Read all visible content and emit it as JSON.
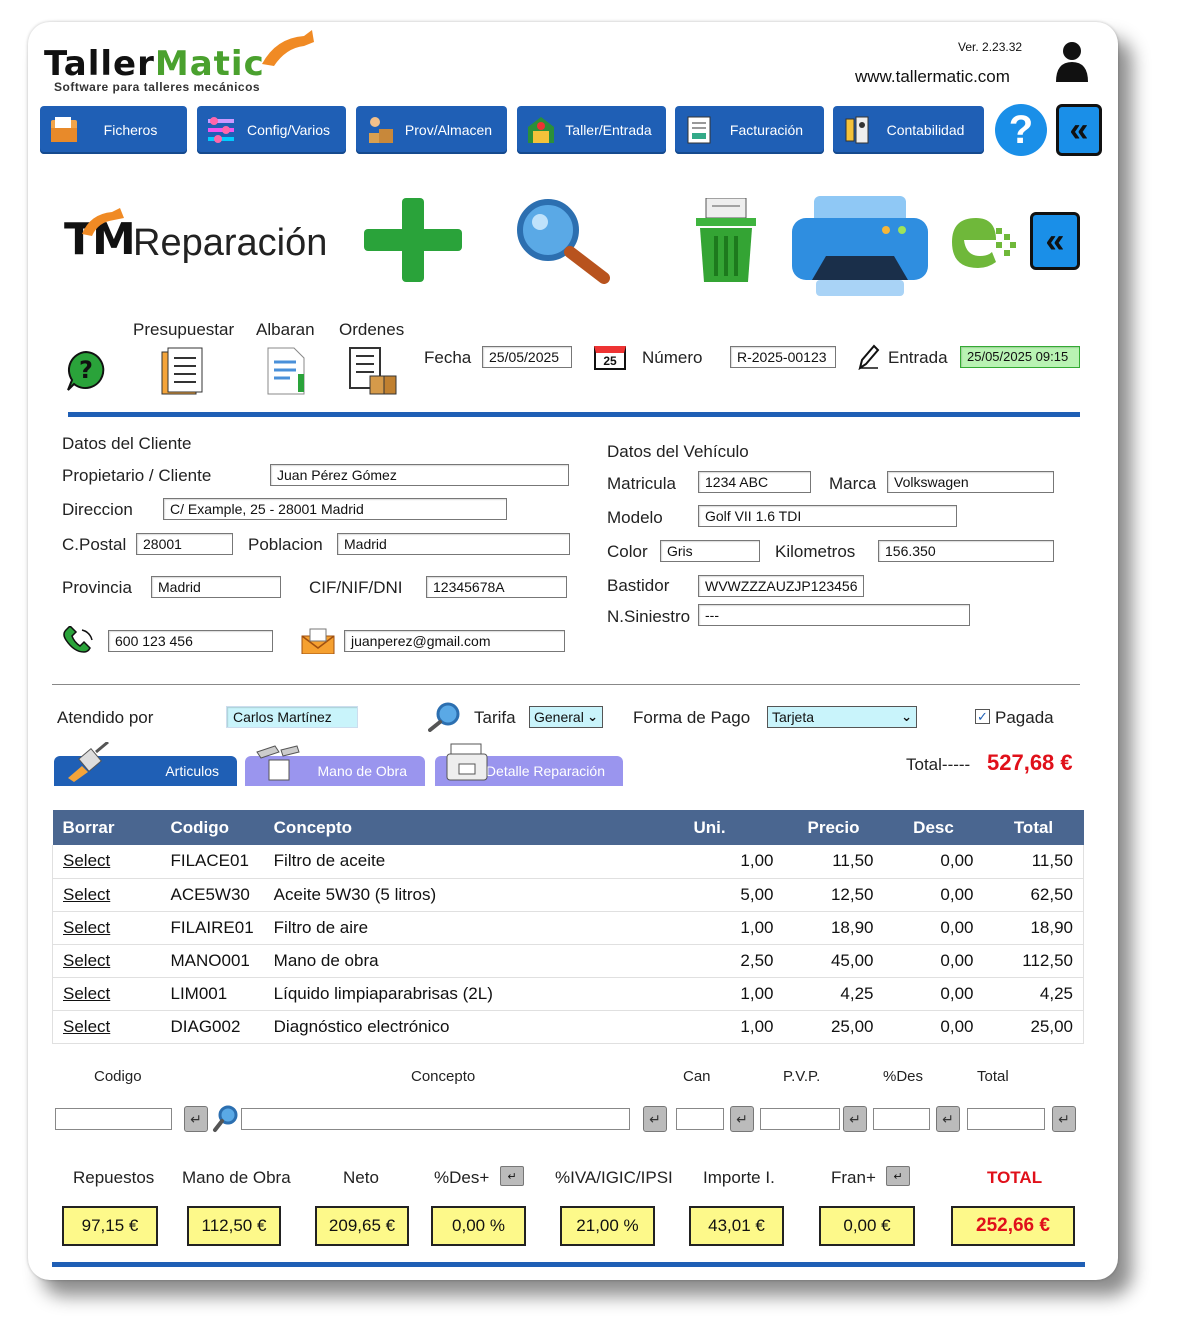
{
  "app": {
    "logo_first": "Taller",
    "logo_second": "Matic",
    "tagline": "Software para talleres mecánicos",
    "version": "Ver. 2.23.32",
    "website": "www.tallermatic.com"
  },
  "nav": {
    "items": [
      {
        "label": "Ficheros"
      },
      {
        "label": "Config/Varios"
      },
      {
        "label": "Prov/Almacen"
      },
      {
        "label": "Taller/Entrada"
      },
      {
        "label": "Facturación"
      },
      {
        "label": "Contabilidad"
      }
    ],
    "help": "?",
    "back": "«"
  },
  "page": {
    "logo": "TM",
    "title": "Reparación"
  },
  "docs": {
    "presupuestar": "Presupuestar",
    "albaran": "Albaran",
    "ordenes": "Ordenes"
  },
  "header_fields": {
    "fecha_label": "Fecha",
    "fecha": "25/05/2025",
    "calendar_day": "25",
    "numero_label": "Número",
    "numero": "R-2025-00123",
    "entrada_label": "Entrada",
    "entrada": "25/05/2025 09:15"
  },
  "cliente": {
    "section": "Datos del Cliente",
    "propietario_label": "Propietario / Cliente",
    "propietario": "Juan Pérez Gómez",
    "direccion_label": "Direccion",
    "direccion": "C/ Example, 25 - 28001 Madrid",
    "cpostal_label": "C.Postal",
    "cpostal": "28001",
    "poblacion_label": "Poblacion",
    "poblacion": "Madrid",
    "provincia_label": "Provincia",
    "provincia": "Madrid",
    "cif_label": "CIF/NIF/DNI",
    "cif": "12345678A",
    "telefono": "600 123 456",
    "email": "juanperez@gmail.com"
  },
  "vehiculo": {
    "section": "Datos del Vehículo",
    "matricula_label": "Matricula",
    "matricula": "1234 ABC",
    "marca_label": "Marca",
    "marca": "Volkswagen",
    "modelo_label": "Modelo",
    "modelo": "Golf VII 1.6 TDI",
    "color_label": "Color",
    "color": "Gris",
    "km_label": "Kilometros",
    "km": "156.350",
    "bastidor_label": "Bastidor",
    "bastidor": "WVWZZZAUZJP123456",
    "siniestro_label": "N.Siniestro",
    "siniestro": "---"
  },
  "atencion": {
    "atendido_label": "Atendido por",
    "atendido": "Carlos Martínez",
    "tarifa_label": "Tarifa",
    "tarifa": "General",
    "pago_label": "Forma de Pago",
    "pago": "Tarjeta",
    "pagada_label": "Pagada",
    "pagada_checked": true,
    "total_label": "Total-----",
    "total": "527,68 €"
  },
  "tabs": [
    {
      "label": "Articulos"
    },
    {
      "label": "Mano de Obra"
    },
    {
      "label": "Detalle Reparación"
    }
  ],
  "table": {
    "headers": [
      "Borrar",
      "Codigo",
      "Concepto",
      "Uni.",
      "Precio",
      "Desc",
      "Total"
    ],
    "rows": [
      {
        "action": "Select",
        "codigo": "FILACE01",
        "concepto": "Filtro de aceite",
        "uni": "1,00",
        "precio": "11,50",
        "desc": "0,00",
        "total": "11,50"
      },
      {
        "action": "Select",
        "codigo": "ACE5W30",
        "concepto": "Aceite 5W30 (5 litros)",
        "uni": "5,00",
        "precio": "12,50",
        "desc": "0,00",
        "total": "62,50"
      },
      {
        "action": "Select",
        "codigo": "FILAIRE01",
        "concepto": "Filtro de aire",
        "uni": "1,00",
        "precio": "18,90",
        "desc": "0,00",
        "total": "18,90"
      },
      {
        "action": "Select",
        "codigo": "MANO001",
        "concepto": "Mano de obra",
        "uni": "2,50",
        "precio": "45,00",
        "desc": "0,00",
        "total": "112,50"
      },
      {
        "action": "Select",
        "codigo": "LIM001",
        "concepto": "Líquido limpiaparabrisas (2L)",
        "uni": "1,00",
        "precio": "4,25",
        "desc": "0,00",
        "total": "4,25"
      },
      {
        "action": "Select",
        "codigo": "DIAG002",
        "concepto": "Diagnóstico electrónico",
        "uni": "1,00",
        "precio": "25,00",
        "desc": "0,00",
        "total": "25,00"
      }
    ]
  },
  "entry": {
    "codigo": "Codigo",
    "concepto": "Concepto",
    "can": "Can",
    "pvp": "P.V.P.",
    "des": "%Des",
    "total": "Total"
  },
  "totals": {
    "repuestos_label": "Repuestos",
    "repuestos": "97,15 €",
    "mano_label": "Mano de Obra",
    "mano": "112,50 €",
    "neto_label": "Neto",
    "neto": "209,65 €",
    "des_label": "%Des+",
    "des": "0,00 %",
    "iva_label": "%IVA/IGIC/IPSI",
    "iva": "21,00 %",
    "importe_label": "Importe I.",
    "importe": "43,01 €",
    "fran_label": "Fran+",
    "fran": "0,00 €",
    "total_label": "TOTAL",
    "total": "252,66 €"
  },
  "colors": {
    "nav_blue": "#1f5fb5",
    "header_row": "#4a6690",
    "total_red": "#e0101a",
    "highlight_yellow": "#fdf98a",
    "entry_green": "#b9f3b3"
  }
}
